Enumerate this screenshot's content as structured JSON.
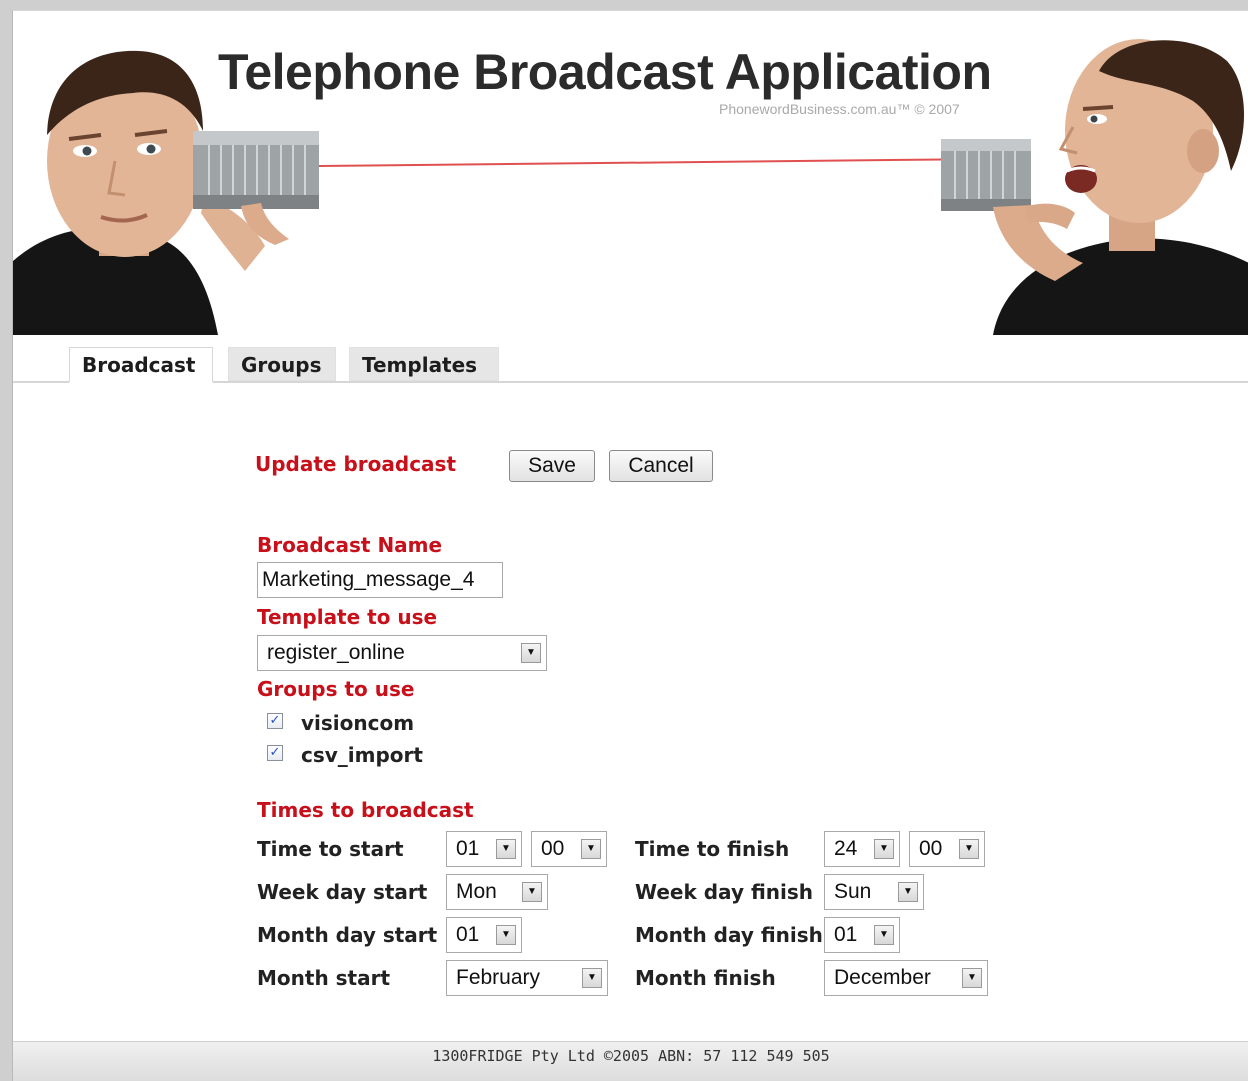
{
  "header": {
    "title": "Telephone Broadcast Application",
    "subtitle": "PhonewordBusiness.com.au™  © 2007"
  },
  "tabs": [
    {
      "label": "Broadcast",
      "active": true
    },
    {
      "label": "Groups",
      "active": false
    },
    {
      "label": "Templates",
      "active": false
    }
  ],
  "form": {
    "heading": "Update broadcast",
    "save_label": "Save",
    "cancel_label": "Cancel",
    "broadcast_name_label": "Broadcast Name",
    "broadcast_name_value": "Marketing_message_4",
    "template_label": "Template to use",
    "template_value": "register_online",
    "groups_label": "Groups to use",
    "groups": [
      {
        "label": "visioncom",
        "checked": true
      },
      {
        "label": "csv_import",
        "checked": true
      }
    ],
    "times_label": "Times to broadcast",
    "time_start_label": "Time to start",
    "time_start_hour": "01",
    "time_start_min": "00",
    "time_finish_label": "Time to finish",
    "time_finish_hour": "24",
    "time_finish_min": "00",
    "week_start_label": "Week day start",
    "week_start_value": "Mon",
    "week_finish_label": "Week day finish",
    "week_finish_value": "Sun",
    "month_day_start_label": "Month day start",
    "month_day_start_value": "01",
    "month_day_finish_label": "Month day finish",
    "month_day_finish_value": "01",
    "month_start_label": "Month start",
    "month_start_value": "February",
    "month_finish_label": "Month finish",
    "month_finish_value": "December"
  },
  "footer": {
    "text": "1300FRIDGE Pty Ltd ©2005 ABN: 57 112 549 505"
  },
  "colors": {
    "accent": "#c8101a",
    "checkmark": "#2a4fb8"
  },
  "icons": {
    "dropdown": "chevron-down-icon",
    "checkbox": "check-icon"
  }
}
